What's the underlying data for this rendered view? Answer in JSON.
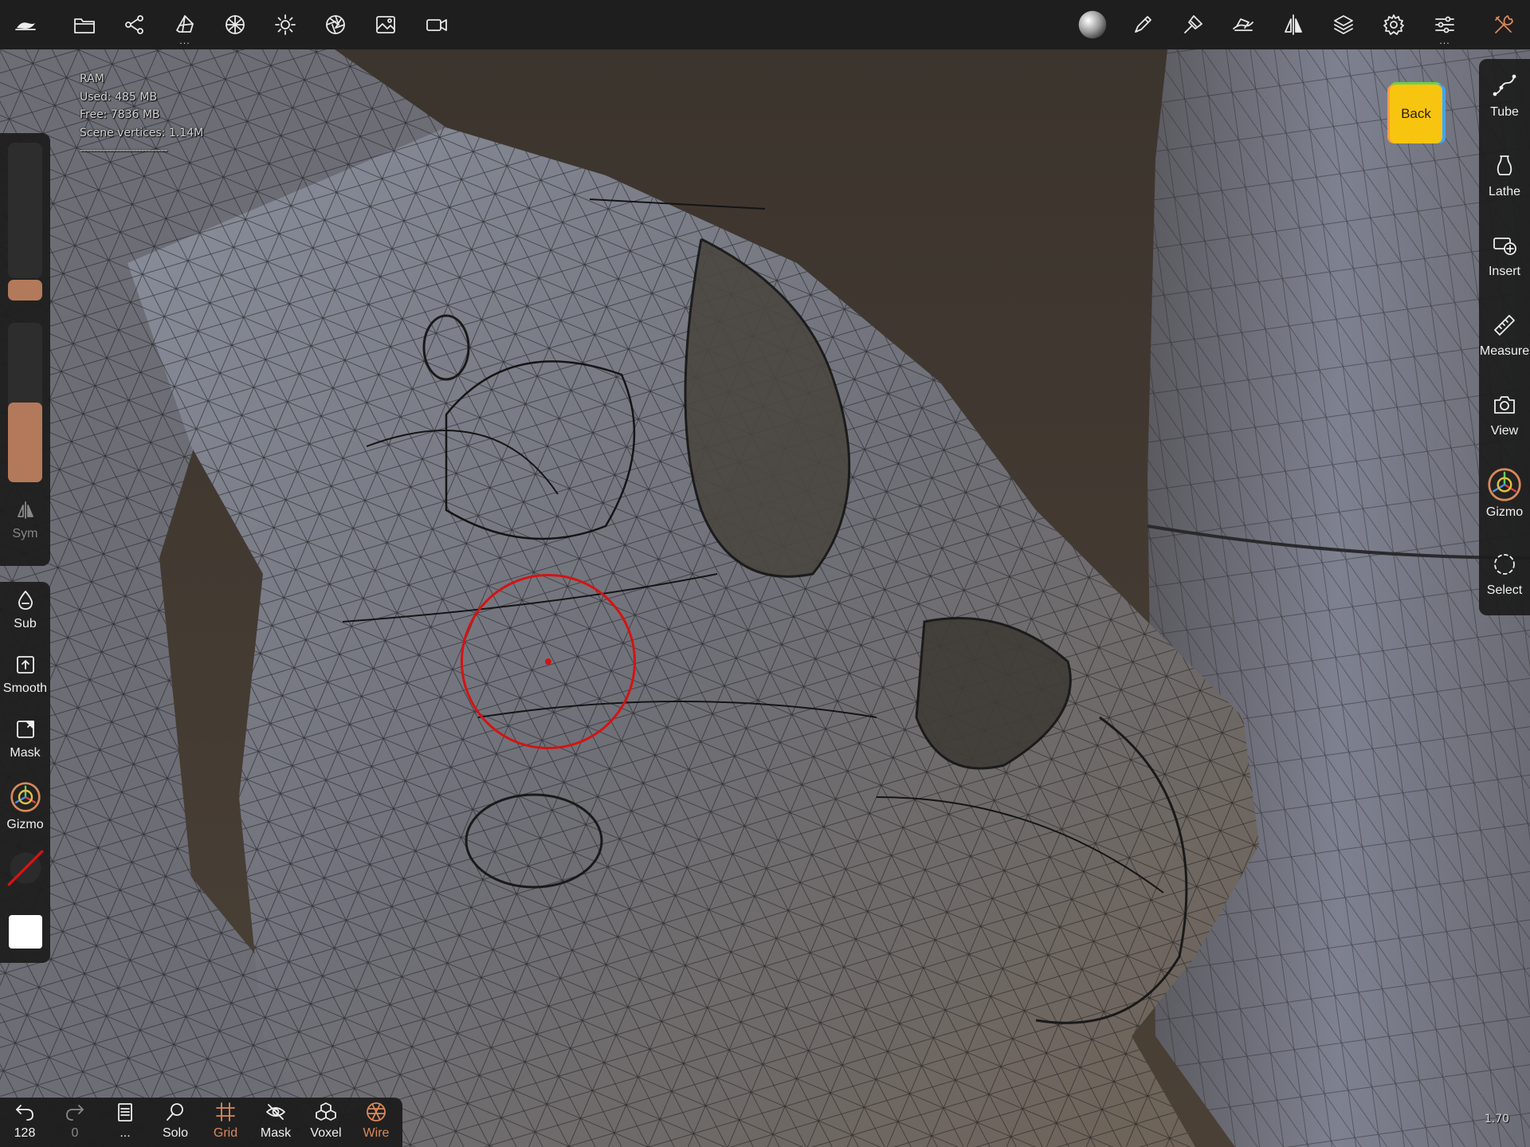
{
  "app": {
    "accent_color": "#d98a5a",
    "toolbar_bg": "#1e1e1e"
  },
  "topbar": {
    "left_icons": [
      "logo-icon",
      "folder-icon",
      "scene-graph-icon",
      "background-icon",
      "material-sphere-icon",
      "light-sun-icon",
      "camera-aperture-icon",
      "image-icon",
      "video-camera-icon"
    ],
    "right_icons": [
      "matcap-sphere-icon",
      "brush-icon",
      "paint-icon",
      "tool-stroke-icon",
      "symmetry-icon",
      "layers-icon",
      "settings-gear-icon",
      "sliders-icon",
      "wrench-tools-icon"
    ]
  },
  "stats": {
    "title": "RAM",
    "used": "Used: 485 MB",
    "free": "Free: 7836 MB",
    "vertices": "Scene vertices: 1.14M",
    "separator": "---------------------------"
  },
  "left_panel": {
    "radius_level": 0.15,
    "intensity_level": 0.5,
    "sym_label": "Sym",
    "sub_label": "Sub",
    "smooth_label": "Smooth",
    "mask_label": "Mask",
    "gizmo_label": "Gizmo",
    "color_swatch": "#ffffff",
    "material_swatch": "#2b2b2b"
  },
  "right_panel": {
    "items": [
      {
        "label": "Tube",
        "icon": "tube-icon"
      },
      {
        "label": "Lathe",
        "icon": "lathe-icon"
      },
      {
        "label": "Insert",
        "icon": "insert-icon"
      },
      {
        "label": "Measure",
        "icon": "ruler-icon"
      },
      {
        "label": "View",
        "icon": "camera-icon"
      },
      {
        "label": "Gizmo",
        "icon": "gizmo-icon"
      },
      {
        "label": "Select",
        "icon": "lasso-select-icon"
      }
    ]
  },
  "nav_cube": {
    "label": "Back"
  },
  "bottom_bar": {
    "undo_label": "128",
    "redo_label": "0",
    "more_label": "...",
    "solo_label": "Solo",
    "grid_label": "Grid",
    "mask_label": "Mask",
    "voxel_label": "Voxel",
    "wire_label": "Wire"
  },
  "viewport": {
    "zoom": "1.70",
    "brush_color": "#d31414"
  }
}
